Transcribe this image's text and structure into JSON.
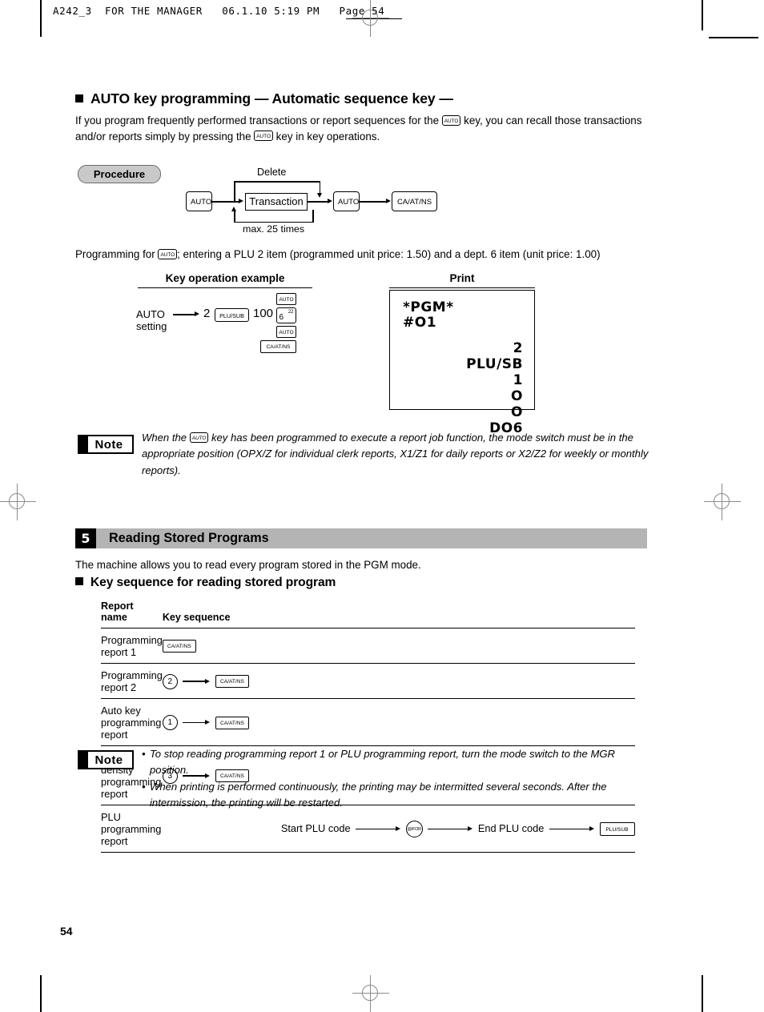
{
  "page": {
    "file_header": "A242_3  FOR THE MANAGER   06.1.10 5:19 PM   Page 54",
    "page_number": "54"
  },
  "auto_section": {
    "title": "AUTO key programming — Automatic sequence key —",
    "intro_part1": "If you program frequently performed transactions or report sequences for the",
    "intro_key1": "AUTO",
    "intro_part2": "key, you can recall those transactions and/or reports simply by pressing the",
    "intro_key2": "AUTO",
    "intro_part3": "key in key operations.",
    "procedure_label": "Procedure",
    "diagram": {
      "delete_label": "Delete",
      "max_label": "max. 25 times",
      "key_auto_start": "AUTO",
      "transaction_box": "Transaction",
      "key_auto_end": "AUTO",
      "key_caats": "CA/AT/NS"
    },
    "programming_line_part1": "Programming for",
    "programming_line_key": "AUTO",
    "programming_line_part2": "; entering a PLU 2 item (programmed unit price: 1.50) and a dept. 6 item (unit price: 1.00)",
    "example_header": "Key operation example",
    "print_header": "Print",
    "example": {
      "label_line1": "AUTO",
      "label_line2": "setting",
      "qty": "2",
      "key_plusub": "PLU/SUB",
      "amount": "100",
      "key_auto_1": "AUTO",
      "key_dept_main": "6",
      "key_dept_sup": "22",
      "key_auto_2": "AUTO",
      "key_caats": "CA/AT/NS"
    },
    "receipt": {
      "head_line1": "*PGM*",
      "head_line2": "#O1",
      "lines": [
        "2",
        "PLU/SB",
        "1",
        "O",
        "O",
        "DO6"
      ]
    },
    "note_label": "Note",
    "note_text_part1": "When the",
    "note_key": "AUTO",
    "note_text_part2": "key has been programmed to execute a report job function, the mode switch must be in the appropriate position (OPX/Z for individual clerk reports, X1/Z1 for daily reports or X2/Z2 for weekly or monthly reports)."
  },
  "reading_section": {
    "number": "5",
    "banner_title": "Reading Stored Programs",
    "intro": "The machine allows you to read every program stored in the PGM mode.",
    "subtitle": "Key sequence for reading stored program",
    "table": {
      "headers": [
        "Report name",
        "Key sequence"
      ],
      "rows": [
        {
          "name": "Programming report 1",
          "sequence": [
            {
              "type": "key",
              "label": "CA/AT/NS"
            }
          ]
        },
        {
          "name": "Programming report 2",
          "sequence": [
            {
              "type": "round",
              "label": "2"
            },
            {
              "type": "arrow"
            },
            {
              "type": "key",
              "label": "CA/AT/NS"
            }
          ]
        },
        {
          "name": "Auto key programming report",
          "sequence": [
            {
              "type": "round",
              "label": "1"
            },
            {
              "type": "arrow"
            },
            {
              "type": "key",
              "label": "CA/AT/NS"
            }
          ]
        },
        {
          "name": "Printer density programming report",
          "sequence": [
            {
              "type": "round",
              "label": "3"
            },
            {
              "type": "arrow"
            },
            {
              "type": "key",
              "label": "CA/AT/NS"
            }
          ]
        },
        {
          "name": "PLU programming report",
          "sequence": [
            {
              "type": "text",
              "label": "Start PLU code"
            },
            {
              "type": "arrow-long"
            },
            {
              "type": "round-for",
              "label": "@/FOR"
            },
            {
              "type": "arrow-long"
            },
            {
              "type": "text",
              "label": "End PLU code"
            },
            {
              "type": "arrow-long"
            },
            {
              "type": "key",
              "label": "PLU/SUB"
            }
          ]
        }
      ]
    },
    "note_label": "Note",
    "note_bullets": [
      "To stop reading programming report 1 or PLU programming report, turn the mode switch to the MGR position.",
      "When printing is performed continuously, the printing may be intermitted several seconds.  After the intermission, the printing will be restarted."
    ]
  },
  "colors": {
    "banner_gray": "#b4b4b4",
    "pill_gray": "#c9c9c9",
    "mark_gray": "#8a8a8a"
  }
}
